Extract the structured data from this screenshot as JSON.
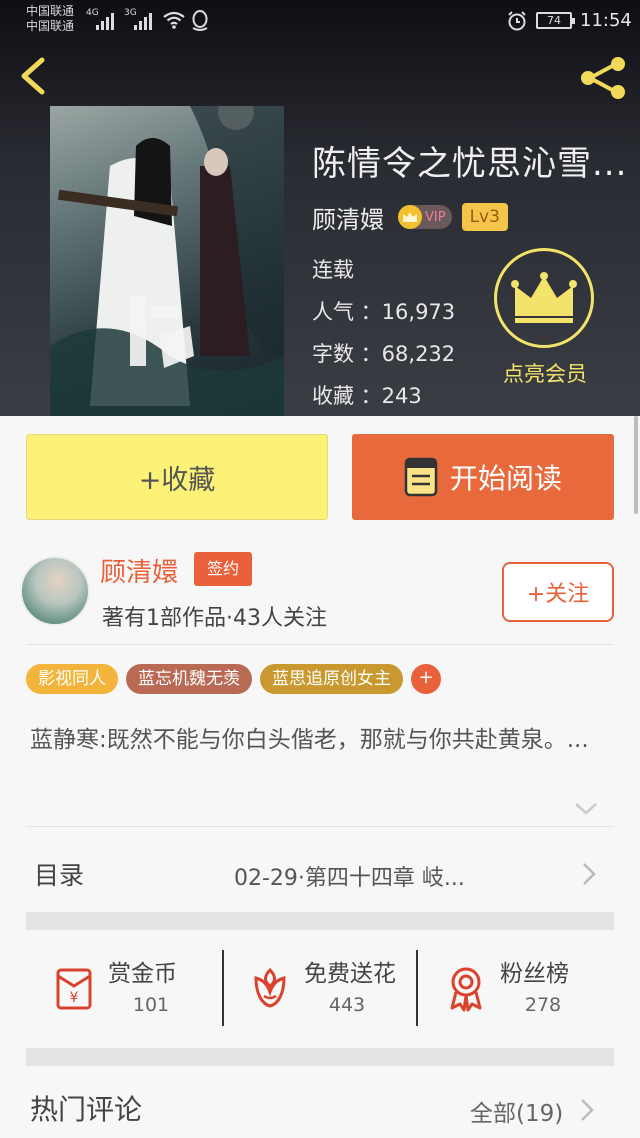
{
  "status_bar": {
    "carrier_1": "中国联通",
    "carrier_2": "中国联通",
    "network_1": "4G",
    "network_2": "3G",
    "battery": "74",
    "time": "11:54"
  },
  "book": {
    "title": "陈情令之忧思沁雪...",
    "author": "顾清嬛",
    "vip_badge": "VIP",
    "level_badge": "Lv3",
    "status": "连载",
    "popularity": "人气 ：16,973",
    "word_count": "字数 ：68,232",
    "favorites": "收藏 ：243"
  },
  "member": {
    "label": "点亮会员"
  },
  "actions": {
    "collect_label": "+收藏",
    "read_label": "开始阅读"
  },
  "author_card": {
    "name": "顾清嬛",
    "sign_badge": "签约",
    "meta": "著有1部作品·43人关注",
    "follow_label": "+关注"
  },
  "tags": [
    {
      "label": "影视同人",
      "color": "#f2b43a"
    },
    {
      "label": "蓝忘机魏无羡",
      "color": "#b86a55"
    },
    {
      "label": "蓝思追原创女主",
      "color": "#c9992f"
    }
  ],
  "tag_more": "+",
  "intro": "蓝静寒:既然不能与你白头偕老，那就与你共赴黄泉。...",
  "toc": {
    "label": "目录",
    "latest": "02-29·第四十四章 岐..."
  },
  "stats": [
    {
      "label": "赏金币",
      "value": "101",
      "icon": "red-envelope-icon"
    },
    {
      "label": "免费送花",
      "value": "443",
      "icon": "flower-icon"
    },
    {
      "label": "粉丝榜",
      "value": "278",
      "icon": "medal-icon"
    }
  ],
  "comments": {
    "title": "热门评论",
    "all_label": "全部(19)"
  },
  "colors": {
    "accent": "#e8613a",
    "collect_button": "#fcf277",
    "member_gold": "#f4e36b"
  }
}
